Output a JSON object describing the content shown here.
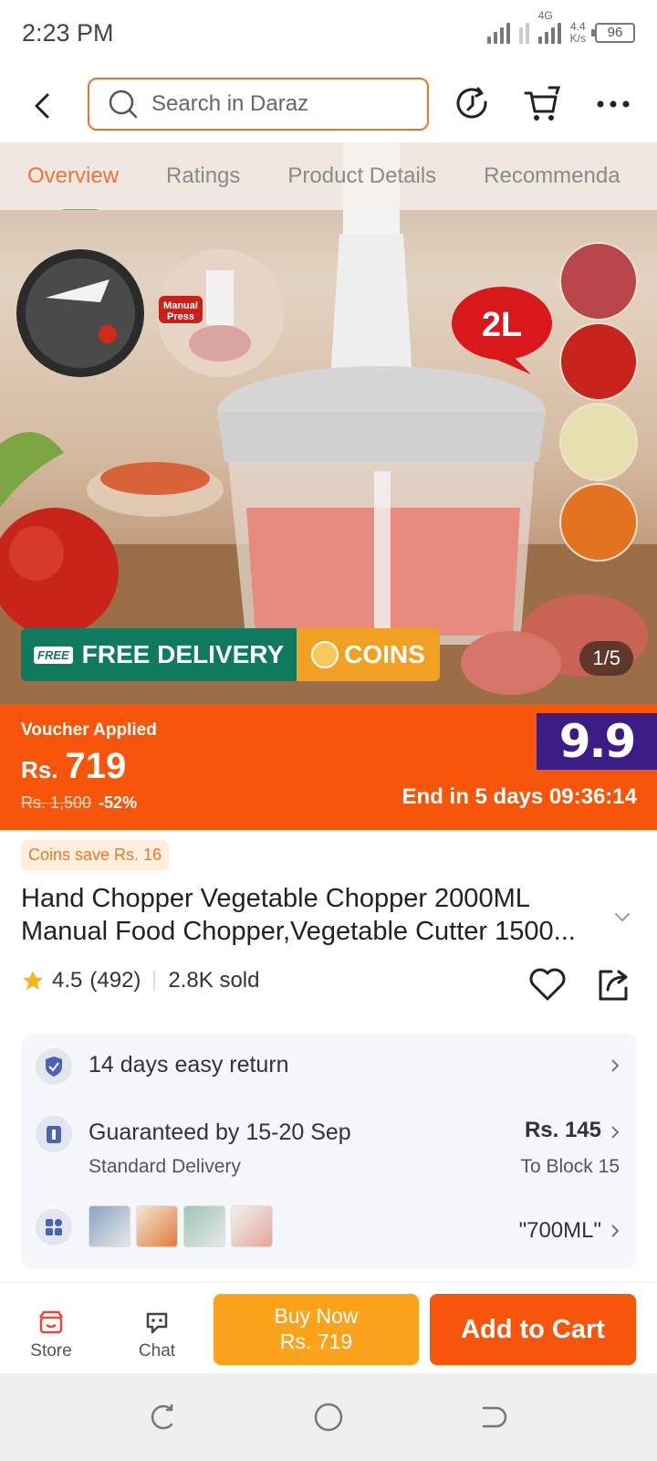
{
  "status_bar": {
    "time": "2:23 PM",
    "network_type": "4G",
    "speed_value": "4.4",
    "speed_unit": "K/s",
    "battery": "96"
  },
  "header": {
    "search_placeholder": "Search in Daraz",
    "icons": [
      "back-arrow-icon",
      "history-icon",
      "cart-icon",
      "more-icon"
    ]
  },
  "hero": {
    "tabs": [
      {
        "label": "Overview",
        "active": true
      },
      {
        "label": "Ratings",
        "active": false
      },
      {
        "label": "Product Details",
        "active": false
      },
      {
        "label": "Recommenda",
        "active": false
      }
    ],
    "image_labels": {
      "capacity": "2L",
      "manual_press": "Manual Press"
    },
    "promo_free_tag": "FREE",
    "promo_free": "FREE DELIVERY",
    "promo_coins": "COINS",
    "image_counter": "1/5"
  },
  "price": {
    "voucher_label": "Voucher Applied",
    "currency": "Rs.",
    "current": "719",
    "original": "Rs. 1,500",
    "discount": "-52%",
    "campaign": "9.9",
    "countdown": "End in 5 days 09:36:14"
  },
  "product": {
    "coins_save": "Coins save Rs. 16",
    "title_line1": "Hand Chopper Vegetable Chopper 2000ML",
    "title_line2": "Manual Food Chopper,Vegetable Cutter 1500...",
    "rating": "4.5",
    "reviews": "(492)",
    "sold": "2.8K sold"
  },
  "service": {
    "return_text": "14 days easy return",
    "delivery_text": "Guaranteed by 15-20 Sep",
    "delivery_sub": "Standard Delivery",
    "delivery_fee": "Rs. 145",
    "delivery_to": "To Block 15",
    "variant_selected": "\"700ML\""
  },
  "bottom_bar": {
    "store_label": "Store",
    "chat_label": "Chat",
    "buy_now_label": "Buy Now",
    "buy_now_price": "Rs. 719",
    "add_to_cart_label": "Add to Cart"
  },
  "colors": {
    "accent_orange": "#f7560a",
    "buy_now_yellow": "#fca31b",
    "free_delivery_green": "#107a5e",
    "campaign_purple": "#3e1c86"
  }
}
